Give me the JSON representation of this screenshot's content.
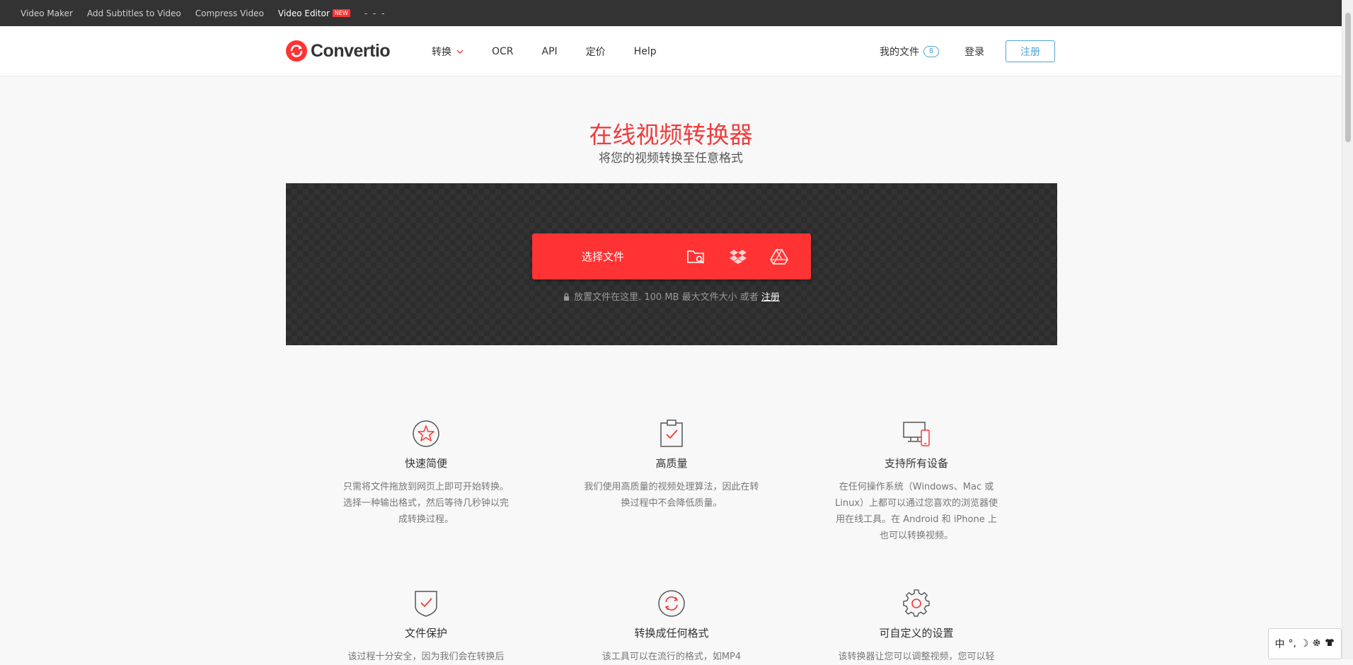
{
  "topbar": {
    "links": [
      "Video Maker",
      "Add Subtitles to Video",
      "Compress Video",
      "Video Editor"
    ],
    "new_badge": "NEW",
    "more": "- - -"
  },
  "header": {
    "logo_text": "Convertio",
    "nav": [
      "转换",
      "OCR",
      "API",
      "定价",
      "Help"
    ],
    "my_files_label": "我的文件",
    "my_files_count": "8",
    "login_label": "登录",
    "signup_label": "注册"
  },
  "hero": {
    "title": "在线视频转换器",
    "subtitle": "将您的视频转换至任意格式"
  },
  "dropzone": {
    "choose_label": "选择文件",
    "hint_text": "放置文件在这里. 100 MB 最大文件大小 或者",
    "hint_link": "注册"
  },
  "features": [
    {
      "icon": "star-icon",
      "title": "快速简便",
      "desc": "只需将文件拖放到网页上即可开始转换。选择一种输出格式，然后等待几秒钟以完成转换过程。"
    },
    {
      "icon": "clipboard-check-icon",
      "title": "高质量",
      "desc": "我们使用高质量的视频处理算法，因此在转换过程中不会降低质量。"
    },
    {
      "icon": "devices-icon",
      "title": "支持所有设备",
      "desc": "在任何操作系统（Windows、Mac 或 Linux）上都可以通过您喜欢的浏览器使用在线工具。在 Android 和 iPhone 上也可以转换视频。"
    },
    {
      "icon": "shield-check-icon",
      "title": "文件保护",
      "desc": "该过程十分安全，因为我们会在转换后"
    },
    {
      "icon": "refresh-icon",
      "title": "转换成任何格式",
      "desc": "该工具可以在流行的格式，如MP4"
    },
    {
      "icon": "gear-icon",
      "title": "可自定义的设置",
      "desc": "该转换器让您可以调整视频，您可以轻"
    }
  ],
  "ime": {
    "lang": "中",
    "punct": "°,",
    "moon": "☽"
  },
  "colors": {
    "accent": "#ff3333",
    "link_blue": "#4fa3d1",
    "topbar_bg": "#333333"
  }
}
